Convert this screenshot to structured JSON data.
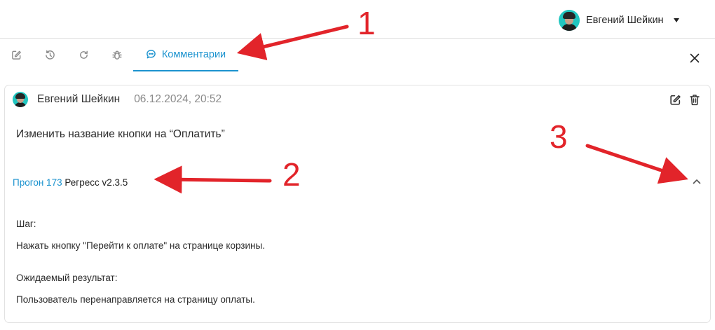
{
  "header": {
    "user_name": "Евгений Шейкин"
  },
  "tabs": {
    "icons": [
      "edit-icon",
      "history-icon",
      "refresh-icon",
      "bug-icon"
    ],
    "active_label": "Комментарии",
    "active_icon": "comment-icon"
  },
  "comment": {
    "author": "Евгений Шейкин",
    "date": "06.12.2024, 20:52",
    "text": "Изменить название кнопки на “Оплатить”",
    "run_link": "Прогон 173",
    "run_name": "Регресс v2.3.5",
    "step_label": "Шаг:",
    "step_text": "Нажать кнопку \"Перейти к оплате\" на странице корзины.",
    "expected_label": "Ожидаемый результат:",
    "expected_text": "Пользователь перенаправляется на страницу оплаты."
  },
  "annotations": {
    "numbers": [
      "1",
      "2",
      "3"
    ],
    "color": "#e2242a"
  },
  "colors": {
    "accent": "#1c93cf",
    "avatar_bg": "#21c6c0"
  }
}
